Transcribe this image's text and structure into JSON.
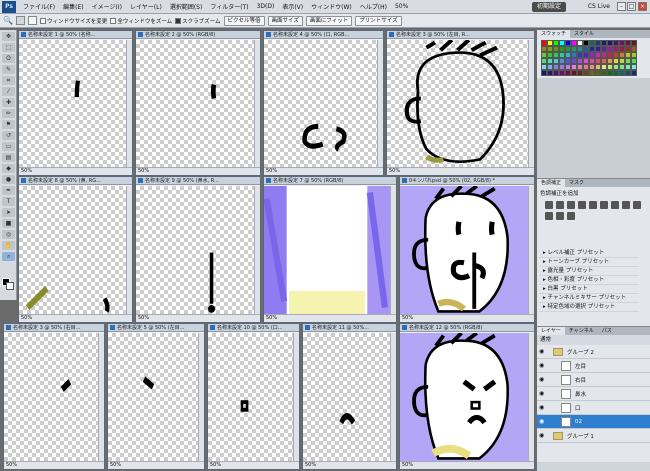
{
  "app": {
    "logo": "Ps"
  },
  "menu": [
    "ファイル(F)",
    "編集(E)",
    "イメージ(I)",
    "レイヤー(L)",
    "選択範囲(S)",
    "フィルター(T)",
    "3D(D)",
    "表示(V)",
    "ウィンドウ(W)",
    "ヘルプ(H)"
  ],
  "workspace_button": "初期設定",
  "cslive": "CS Live",
  "zoom_menu": "50%",
  "options": {
    "resize_windows": "ウィンドウサイズを変更",
    "zoom_all": "全ウィンドウをズーム",
    "scrubby_zoom": "スクラブズーム",
    "actual_pixels": "ピクセル等倍",
    "fit_screen": "画面サイズ",
    "fill_screen": "画面にフィット",
    "print_size": "プリントサイズ"
  },
  "docs": [
    {
      "title": "名称未設定 1 @ 50% (名称...",
      "zoom": "50%"
    },
    {
      "title": "名称未設定 2 @ 50% (RGB/8)",
      "zoom": "50%"
    },
    {
      "title": "名称未設定 4 @ 50% (口, RGB...",
      "zoom": "50%"
    },
    {
      "title": "名称未設定 3 @ 50% (左目, R...",
      "zoom": "50%"
    },
    {
      "title": "名称未設定 8 @ 50% (鼻, RG...",
      "zoom": "50%"
    },
    {
      "title": "名称未設定 9 @ 50% (鼻水, R...",
      "zoom": "50%"
    },
    {
      "title": "名称未設定 7 @ 50% (RGB/8)",
      "zoom": "50%"
    },
    {
      "title": "0キンパれpsd @ 50% (02, RGB/8) *",
      "zoom": "50%"
    },
    {
      "title": "名称未設定 3 @ 50% (右目...",
      "zoom": "50%"
    },
    {
      "title": "名称未設定 5 @ 50% (左目...",
      "zoom": "50%"
    },
    {
      "title": "名称未設定 10 @ 50% (口...",
      "zoom": "50%"
    },
    {
      "title": "名称未設定 11 @ 50%...",
      "zoom": "50%"
    },
    {
      "title": "名称未設定 12 @ 50% (RGB/8)",
      "zoom": "50%"
    }
  ],
  "panels": {
    "swatch_tabs": [
      "スウォッチ",
      "スタイル"
    ],
    "adjust_tabs": [
      "色調補正",
      "マスク"
    ],
    "adjust_title": "色調補正を追加",
    "presets": [
      "レベル補正 プリセット",
      "トーンカーブ プリセット",
      "露光量 プリセット",
      "色相・彩度 プリセット",
      "白黒 プリセット",
      "チャンネルミキサー プリセット",
      "特定色域の選択 プリセット"
    ],
    "layer_tabs": [
      "レイヤー",
      "チャンネル",
      "パス"
    ],
    "blend": "通常",
    "layers": [
      {
        "name": "グループ 2",
        "type": "group"
      },
      {
        "name": "左目",
        "type": "layer"
      },
      {
        "name": "右目",
        "type": "layer"
      },
      {
        "name": "鼻水",
        "type": "layer"
      },
      {
        "name": "口",
        "type": "layer"
      },
      {
        "name": "02",
        "type": "layer",
        "selected": true
      },
      {
        "name": "グループ 1",
        "type": "group"
      }
    ]
  },
  "colors": {
    "accent": "#2f7fd1",
    "purple": "#8f7cf0",
    "yellow": "#f6f3b0"
  }
}
